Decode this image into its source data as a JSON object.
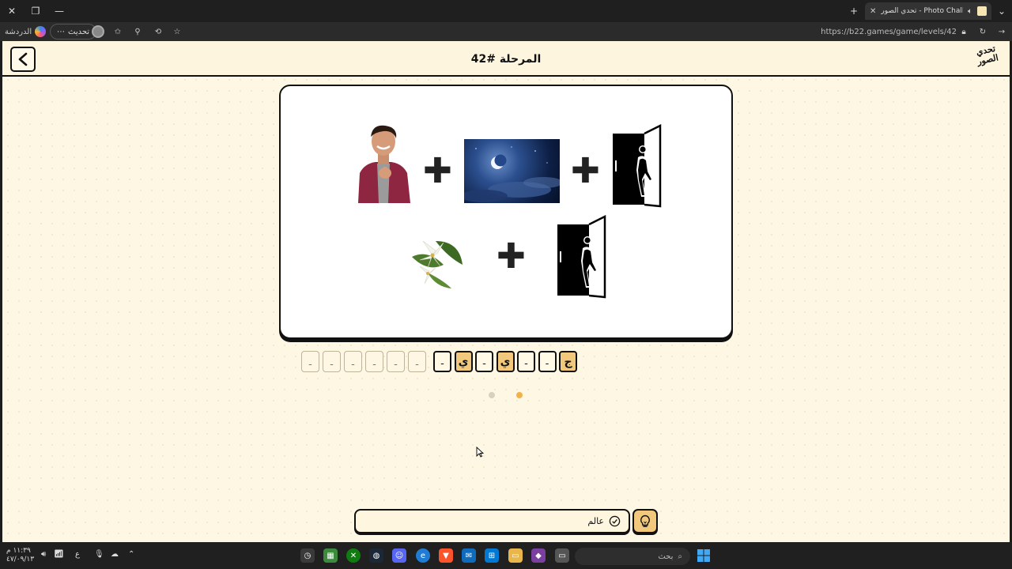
{
  "browser": {
    "tab_title": "تحدي الصور - Photo Challenge",
    "url": "https://b22.games/game/levels/42",
    "update_label": "تحديث",
    "chat_label": "الدردشة",
    "more_label": "⋯"
  },
  "game": {
    "level_title": "المرحلة #42",
    "logo_text": "تحدي الصور",
    "word1_slots": [
      "ـ",
      "ـ",
      "ـ",
      "ـ",
      "ـ",
      "ـ"
    ],
    "word2_slots": [
      {
        "char": "ـ",
        "filled": false
      },
      {
        "char": "ي",
        "filled": true
      },
      {
        "char": "ـ",
        "filled": false
      },
      {
        "char": "ي",
        "filled": true
      },
      {
        "char": "ـ",
        "filled": false
      },
      {
        "char": "ـ",
        "filled": false
      },
      {
        "char": "ج",
        "filled": true
      }
    ],
    "hint_text": "عالم",
    "dot_colors": {
      "inactive": "#d8d2bd",
      "active": "#f2b24a"
    },
    "accent": "#f2c97c"
  },
  "taskbar": {
    "search_placeholder": "بحث",
    "time": "١١:٣٩ م",
    "date": "٤٧/٠٩/١٣",
    "lang": "ع"
  }
}
